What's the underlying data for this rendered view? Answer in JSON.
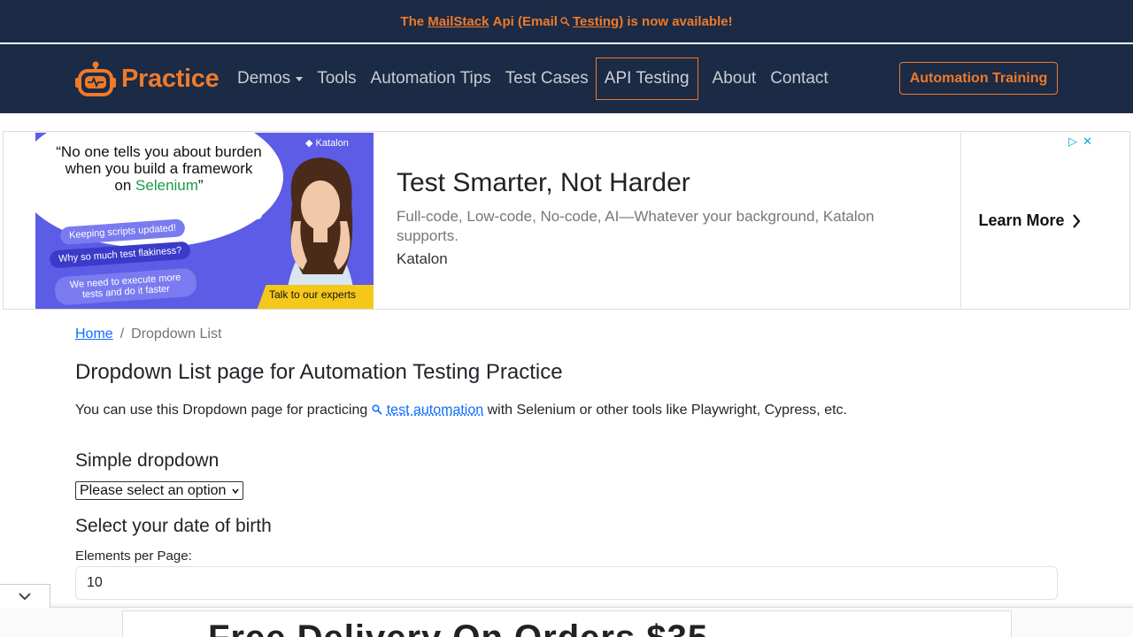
{
  "announcement": {
    "prefix": "The",
    "link_text": "MailStack",
    "middle": "Api (Email",
    "testing_link": "Testing)",
    "suffix": "is now available!"
  },
  "navbar": {
    "brand": "Practice",
    "items": [
      {
        "label": "Demos",
        "dropdown": true
      },
      {
        "label": "Tools"
      },
      {
        "label": "Automation Tips"
      },
      {
        "label": "Test Cases"
      },
      {
        "label": "API Testing",
        "active": true
      },
      {
        "label": "About"
      },
      {
        "label": "Contact"
      }
    ],
    "training_button": "Automation Training"
  },
  "ad_banner": {
    "quote_line1": "“No one tells you about burden when you build a framework on",
    "quote_highlight": "Selenium",
    "quote_end": "”",
    "brand_tag": "Katalon",
    "pill1": "Keeping scripts updated!",
    "pill2": "Why so much test flakiness?",
    "pill3": "We need to execute more tests and do it faster",
    "experts": "Talk to our experts",
    "headline": "Test Smarter, Not Harder",
    "body": "Full-code, Low-code, No-code, AI—Whatever your background, Katalon supports.",
    "advertiser": "Katalon",
    "cta": "Learn More"
  },
  "breadcrumb": {
    "home": "Home",
    "separator": "/",
    "current": "Dropdown List"
  },
  "page": {
    "title": "Dropdown List page for Automation Testing Practice",
    "intro_before": "You can use this Dropdown page for practicing",
    "intro_link": "test automation",
    "intro_after": "with Selenium or other tools like Playwright, Cypress, etc.",
    "simple_heading": "Simple dropdown",
    "simple_selected": "Please select an option",
    "dob_heading": "Select your date of birth",
    "epp_label": "Elements per Page:",
    "epp_value": "10"
  },
  "bottom_ad": {
    "text": "Free Delivery On Orders $35"
  },
  "colors": {
    "navy": "#1b2a45",
    "accent": "#ee7a2a",
    "link": "#0d6efd"
  }
}
